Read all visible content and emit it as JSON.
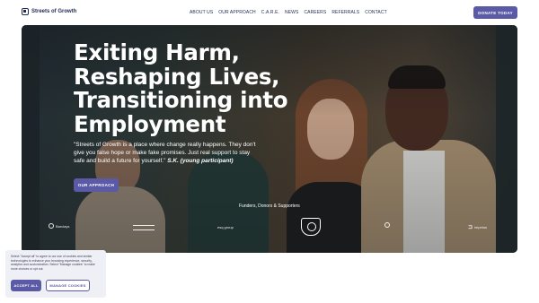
{
  "header": {
    "logo_text": "Streets of Growth",
    "logo_icon": "square-logo-icon",
    "nav": [
      "ABOUT US",
      "OUR APPROACH",
      "C.A.R.E.",
      "NEWS",
      "CAREERS",
      "REFERRALS",
      "CONTACT"
    ],
    "donate_label": "DONATE TODAY"
  },
  "hero": {
    "headline": [
      "Exiting Harm,",
      "Reshaping Lives,",
      "Transitioning into",
      "Employment"
    ],
    "quote": "\"Streets of Growth is a place where change really happens. They don't give you false hope or make fake promises. Just real support to stay safe and build a future for yourself.\"",
    "quote_author": "S.K. (young participant)",
    "cta_label": "OUR APPROACH",
    "funders_title": "Funders, Donors & Supporters",
    "funder_logos": [
      {
        "name": "Barclays",
        "icon": "circle-logo-icon"
      },
      {
        "name": "",
        "icon": "text-logo-icon"
      },
      {
        "name": "esq group",
        "icon": "wordmark-logo-icon"
      },
      {
        "name": "",
        "icon": "crest-logo-icon"
      },
      {
        "name": "",
        "icon": "circle-logo-icon"
      },
      {
        "name": "impetus",
        "icon": "wordmark-logo-icon"
      }
    ]
  },
  "cookie_banner": {
    "text": "Select \"Accept all\" to agree to our use of cookies and similar technologies to enhance your browsing experience, security, analytics and customization. Select \"Manage cookies\" to make more choices or opt out.",
    "accept_label": "ACCEPT ALL",
    "manage_label": "MANAGE COOKIES"
  },
  "colors": {
    "brand_purple": "#5a5aa6",
    "nav_text": "#1f2a52"
  }
}
